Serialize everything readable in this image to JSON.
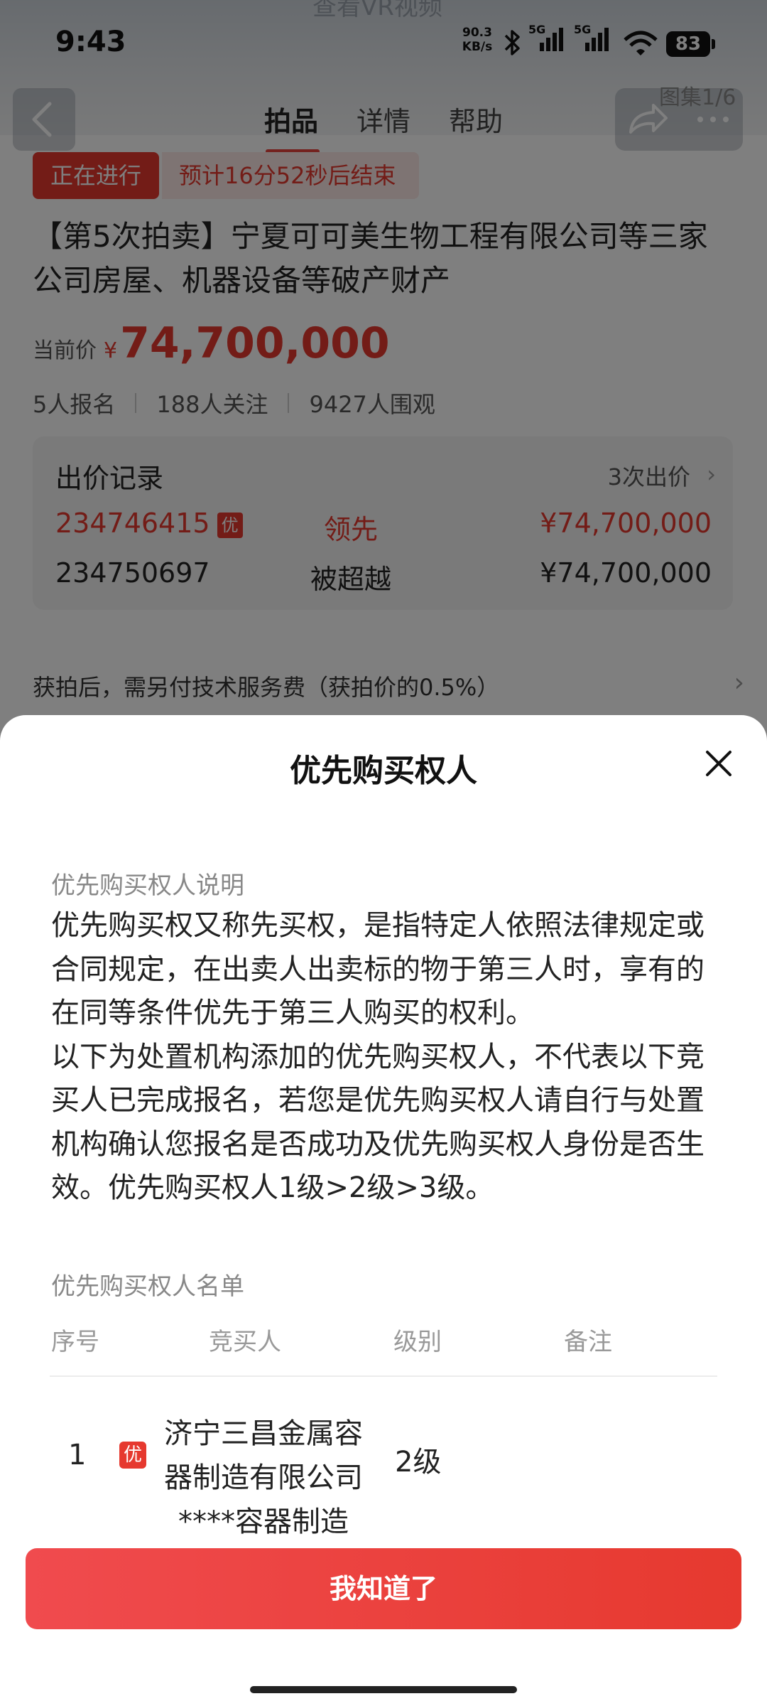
{
  "status_bar": {
    "time": "9:43",
    "net_speed_value": "90.3",
    "net_speed_unit": "KB/s",
    "signal_1_label": "5G",
    "signal_2_label": "5G",
    "battery": "83"
  },
  "hero": {
    "caption": "查看VR视频",
    "gallery_count": "图集1/6"
  },
  "nav": {
    "tabs": [
      {
        "label": "拍品"
      },
      {
        "label": "详情"
      },
      {
        "label": "帮助"
      }
    ]
  },
  "auction": {
    "status_badge": "正在进行",
    "countdown": "预计16分52秒后结束",
    "title": "【第5次拍卖】宁夏可可美生物工程有限公司等三家公司房屋、机器设备等破产财产",
    "price_label": "当前价",
    "price_currency": "¥",
    "price_value": "74,700,000",
    "stats": {
      "registered": "5人报名",
      "followers": "188人关注",
      "viewers": "9427人围观"
    }
  },
  "bid_record": {
    "title": "出价记录",
    "count": "3次出价",
    "rows": [
      {
        "bidder": "234746415",
        "tag": "优",
        "status": "领先",
        "amount": "¥74,700,000"
      },
      {
        "bidder": "234750697",
        "status": "被超越",
        "amount": "¥74,700,000"
      }
    ]
  },
  "fee_notice": "获拍后，需另付技术服务费（获拍价的0.5%）",
  "sheet": {
    "title": "优先购买权人",
    "desc_label": "优先购买权人说明",
    "desc_p1": "优先购买权又称先买权，是指特定人依照法律规定或合同规定，在出卖人出卖标的物于第三人时，享有的在同等条件优先于第三人购买的权利。",
    "desc_p2": "以下为处置机构添加的优先购买权人，不代表以下竞买人已完成报名，若您是优先购买权人请自行与处置机构确认您报名是否成功及优先购买权人身份是否生效。优先购买权人1级>2级>3级。",
    "list_label": "优先购买权人名单",
    "columns": {
      "index": "序号",
      "bidder": "竞买人",
      "level": "级别",
      "remark": "备注"
    },
    "rows": [
      {
        "index": "1",
        "tag": "优",
        "name": "济宁三昌金属容器制造有限公司",
        "masked": "****容器制造",
        "level": "2级",
        "remark": ""
      }
    ],
    "confirm_label": "我知道了"
  },
  "colors": {
    "accent": "#e6392f",
    "accent_light": "#fde9e7"
  },
  "icons": [
    "back-arrow-icon",
    "share-icon",
    "more-icon",
    "bluetooth-icon",
    "signal-icon",
    "wifi-icon",
    "close-icon",
    "chevron-right-icon"
  ]
}
